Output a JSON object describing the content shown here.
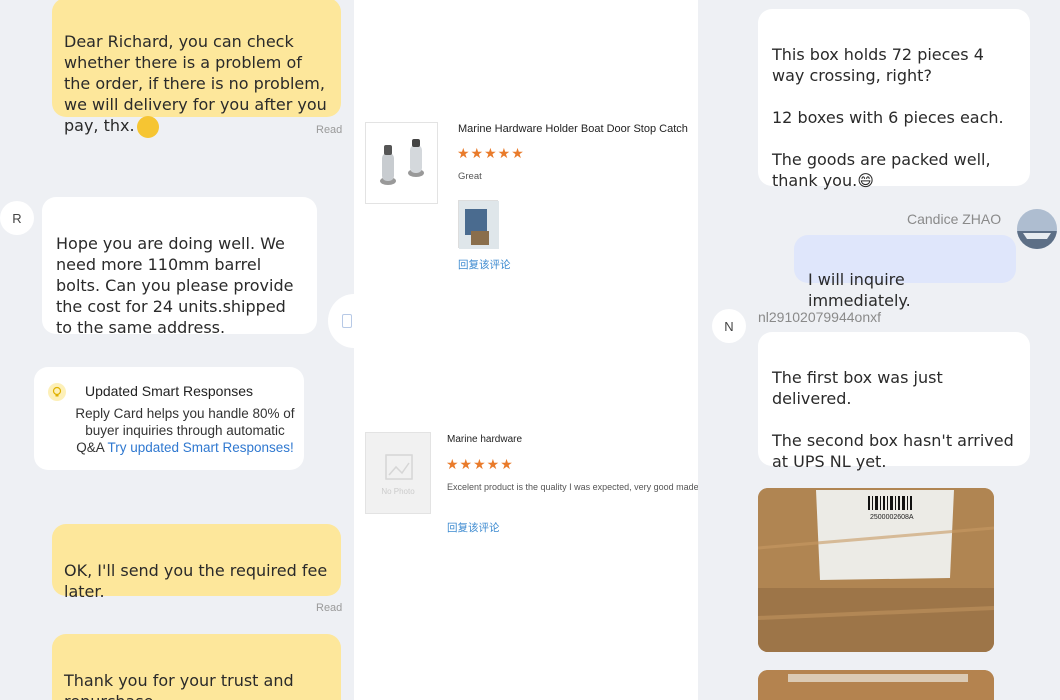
{
  "left": {
    "msg1": "Dear Richard, you can check whether there is a problem of the order, if there is no problem, we will delivery for you after you pay, thx.",
    "msg1_read": "Read",
    "avatar_r": "R",
    "msg2": "Hope you are doing well. We need more 110mm barrel bolts. Can you please provide the cost for 24 units.shipped to the same address.",
    "smart_title": "Updated Smart Responses",
    "smart_body": "Reply Card helps you handle 80% of buyer inquiries through automatic Q&A",
    "smart_link": "Try updated Smart Responses!",
    "msg3": "OK, I'll send you the required fee later.",
    "msg3_read": "Read",
    "msg4": "Thank you for your trust and repurchase."
  },
  "middle": {
    "review1": {
      "title": "Marine Hardware Holder Boat Door Stop Catch",
      "stars": "★★★★★",
      "text": "Great",
      "reply": "回复该评论"
    },
    "review2": {
      "title": "Marine hardware",
      "stars": "★★★★★",
      "text": "Excelent product is the quality I was expected, very good made.",
      "reply": "回复该评论",
      "no_photo": "No Photo"
    }
  },
  "right": {
    "msg1": "This box holds 72 pieces 4 way crossing, right?\n\n12 boxes with 6 pieces each.\n\nThe goods are packed well, thank you.😄",
    "candice_name": "Candice ZHAO",
    "msg2": "I will inquire immediately.",
    "avatar_n": "N",
    "nl_name": "nl29102079944onxf",
    "msg3": "The first box was just delivered.\n\nThe second box hasn't arrived at UPS NL yet.",
    "box_label": "2500002608A"
  }
}
